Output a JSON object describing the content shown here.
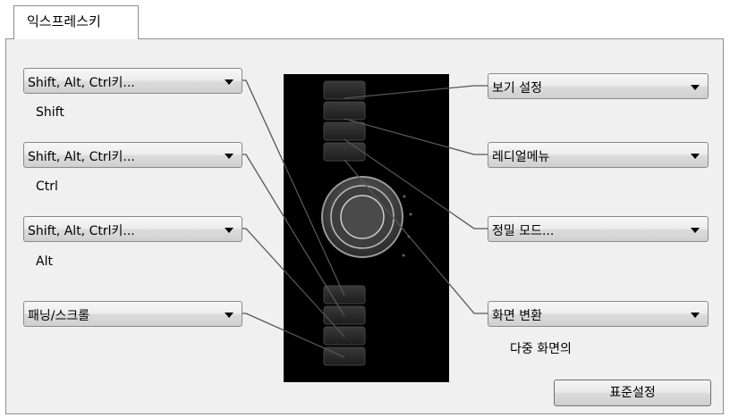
{
  "tab": {
    "label": "익스프레스키"
  },
  "left_dropdowns": [
    {
      "value": "Shift, Alt, Ctrl키...",
      "sublabel": "Shift"
    },
    {
      "value": "Shift, Alt, Ctrl키...",
      "sublabel": "Ctrl"
    },
    {
      "value": "Shift, Alt, Ctrl키...",
      "sublabel": "Alt"
    },
    {
      "value": "패닝/스크롤"
    }
  ],
  "right_dropdowns": [
    {
      "value": "보기 설정"
    },
    {
      "value": "레디얼메뉴"
    },
    {
      "value": "정밀 모드..."
    },
    {
      "value": "화면 변환",
      "sublabel": "다중 화면의"
    }
  ],
  "default_button": {
    "label": "표준설정"
  },
  "icons": [
    "chevron-down-icon",
    "touch-ring-icon"
  ]
}
